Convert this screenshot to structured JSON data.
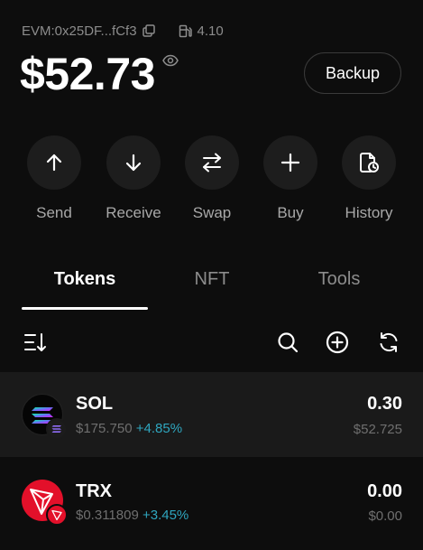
{
  "wallet": {
    "address": "EVM:0x25DF...fCf3",
    "gas_balance": "4.10",
    "balance": "$52.73",
    "backup_label": "Backup"
  },
  "actions": [
    {
      "label": "Send",
      "icon": "arrow-up-icon"
    },
    {
      "label": "Receive",
      "icon": "arrow-down-icon"
    },
    {
      "label": "Swap",
      "icon": "swap-icon"
    },
    {
      "label": "Buy",
      "icon": "plus-icon"
    },
    {
      "label": "History",
      "icon": "history-icon"
    }
  ],
  "tabs": [
    {
      "label": "Tokens",
      "active": true
    },
    {
      "label": "NFT",
      "active": false
    },
    {
      "label": "Tools",
      "active": false
    }
  ],
  "toolbar": {
    "icons": [
      "sort-icon",
      "search-icon",
      "add-token-icon",
      "refresh-icon"
    ]
  },
  "tokens": [
    {
      "symbol": "SOL",
      "price": "$175.750",
      "change": "+4.85%",
      "amount": "0.30",
      "value": "$52.725",
      "icon": "solana-icon"
    },
    {
      "symbol": "TRX",
      "price": "$0.311809",
      "change": "+3.45%",
      "amount": "0.00",
      "value": "$0.00",
      "icon": "tron-icon"
    }
  ],
  "colors": {
    "background": "#0d0d0d",
    "highlight_row": "#1a1a1a",
    "positive_change": "#2fa6bf",
    "tron_red": "#e3102a"
  }
}
